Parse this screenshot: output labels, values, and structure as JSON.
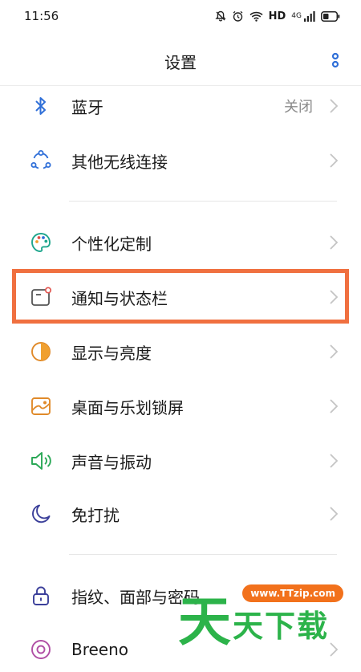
{
  "status_bar": {
    "time": "11:56",
    "hd": "HD",
    "network": "4G"
  },
  "header": {
    "title": "设置"
  },
  "rows": [
    {
      "label": "蓝牙",
      "value": "关闭",
      "icon": "bluetooth-icon"
    },
    {
      "label": "其他无线连接",
      "icon": "wireless-connection-icon"
    },
    {
      "label": "个性化定制",
      "icon": "palette-icon"
    },
    {
      "label": "通知与状态栏",
      "icon": "notification-icon"
    },
    {
      "label": "显示与亮度",
      "icon": "brightness-icon"
    },
    {
      "label": "桌面与乐划锁屏",
      "icon": "wallpaper-icon"
    },
    {
      "label": "声音与振动",
      "icon": "speaker-icon"
    },
    {
      "label": "免打扰",
      "icon": "moon-icon"
    },
    {
      "label": "指纹、面部与密码",
      "icon": "lock-icon"
    },
    {
      "label": "Breeno",
      "icon": "breeno-icon"
    }
  ],
  "watermark": {
    "url": "www.TTzip.com",
    "big": "天",
    "rest": "天下载"
  },
  "colors": {
    "accent": "#2f6fd8",
    "highlight": "#f07040",
    "watermark_green": "#2cb34a",
    "watermark_orange": "#f2711c"
  }
}
